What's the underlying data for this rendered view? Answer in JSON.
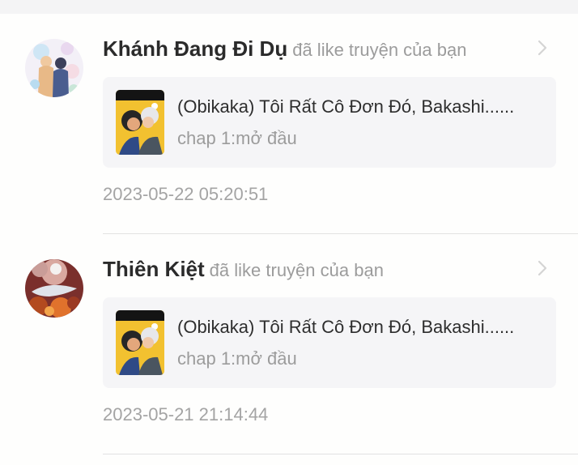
{
  "notifications": [
    {
      "username": "Khánh Đang Đi Dụ",
      "action": "đã like truyện của bạn",
      "story_title": "(Obikaka) Tôi Rất Cô Đơn Đó, Bakashi......",
      "chapter": "chap 1:mở đầu",
      "timestamp": "2023-05-22 05:20:51"
    },
    {
      "username": "Thiên Kiệt",
      "action": "đã like truyện của bạn",
      "story_title": "(Obikaka) Tôi Rất Cô Đơn Đó, Bakashi......",
      "chapter": "chap 1:mở đầu",
      "timestamp": "2023-05-21 21:14:44"
    }
  ],
  "colors": {
    "background": "#fefefd",
    "card_background": "#f5f5f7",
    "username": "#2b2b2b",
    "muted_text": "#9c9c9c",
    "divider": "#e2e2e2"
  }
}
